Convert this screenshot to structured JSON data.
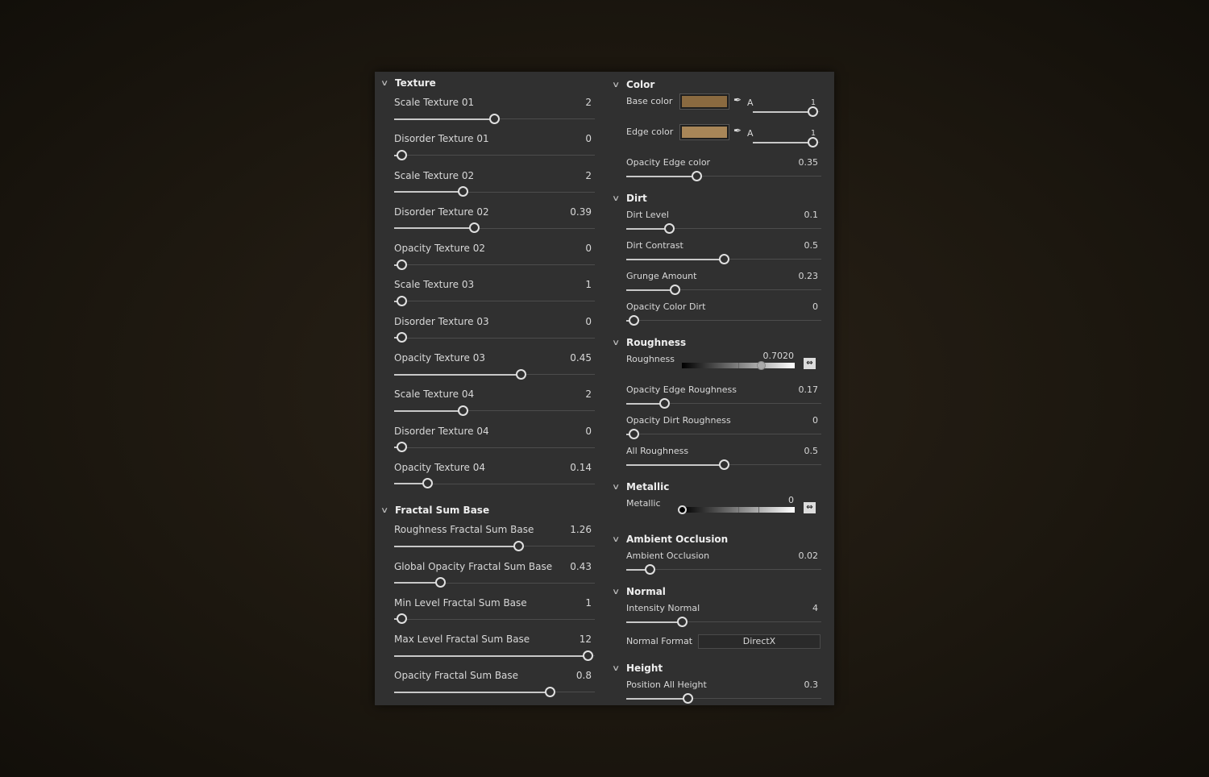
{
  "left": [
    {
      "title": "Texture",
      "rows": [
        {
          "label": "Scale Texture 01",
          "value": "2",
          "fraction": 0.5
        },
        {
          "label": "Disorder Texture 01",
          "value": "0",
          "fraction": 0
        },
        {
          "label": "Scale Texture 02",
          "value": "2",
          "fraction": 0.33
        },
        {
          "label": "Disorder Texture 02",
          "value": "0.39",
          "fraction": 0.39
        },
        {
          "label": "Opacity Texture 02",
          "value": "0",
          "fraction": 0
        },
        {
          "label": "Scale Texture 03",
          "value": "1",
          "fraction": 0
        },
        {
          "label": "Disorder Texture 03",
          "value": "0",
          "fraction": 0
        },
        {
          "label": "Opacity Texture 03",
          "value": "0.45",
          "fraction": 0.645
        },
        {
          "label": "Scale Texture 04",
          "value": "2",
          "fraction": 0.33
        },
        {
          "label": "Disorder Texture 04",
          "value": "0",
          "fraction": 0
        },
        {
          "label": "Opacity Texture 04",
          "value": "0.14",
          "fraction": 0.14
        }
      ]
    },
    {
      "title": "Fractal Sum Base",
      "rows": [
        {
          "label": "Roughness Fractal Sum Base",
          "value": "1.26",
          "fraction": 0.63
        },
        {
          "label": "Global Opacity Fractal Sum Base",
          "value": "0.43",
          "fraction": 0.21
        },
        {
          "label": "Min Level Fractal Sum Base",
          "value": "1",
          "fraction": 0
        },
        {
          "label": "Max Level Fractal Sum Base",
          "value": "12",
          "fraction": 1
        },
        {
          "label": "Opacity Fractal Sum Base",
          "value": "0.8",
          "fraction": 0.8
        }
      ]
    }
  ],
  "right": [
    {
      "title": "Color",
      "rows": [
        {
          "type": "color",
          "label": "Base color",
          "color": "#8a6a40",
          "alpha_label": "A",
          "alpha_value": "1",
          "alpha_fraction": 1
        },
        {
          "type": "color",
          "label": "Edge color",
          "color": "#a88658",
          "alpha_label": "A",
          "alpha_value": "1",
          "alpha_fraction": 1
        },
        {
          "type": "slider",
          "label": "Opacity Edge color",
          "value": "0.35",
          "fraction": 0.35
        }
      ]
    },
    {
      "title": "Dirt",
      "rows": [
        {
          "type": "slider",
          "label": "Dirt Level",
          "value": "0.1",
          "fraction": 0.2
        },
        {
          "type": "slider",
          "label": "Dirt Contrast",
          "value": "0.5",
          "fraction": 0.5
        },
        {
          "type": "slider",
          "label": "Grunge Amount",
          "value": "0.23",
          "fraction": 0.23
        },
        {
          "type": "slider",
          "label": "Opacity Color Dirt",
          "value": "0",
          "fraction": 0
        }
      ]
    },
    {
      "title": "Roughness",
      "rows": [
        {
          "type": "gradient",
          "label": "Roughness",
          "value": "0.7020",
          "fraction": 0.702
        },
        {
          "type": "slider",
          "label": "Opacity Edge Roughness",
          "value": "0.17",
          "fraction": 0.17
        },
        {
          "type": "slider",
          "label": "Opacity Dirt Roughness",
          "value": "0",
          "fraction": 0
        },
        {
          "type": "slider",
          "label": "All Roughness",
          "value": "0.5",
          "fraction": 0.5
        }
      ]
    },
    {
      "title": "Metallic",
      "rows": [
        {
          "type": "gradient",
          "label": "Metallic",
          "value": "0",
          "fraction": 0
        }
      ]
    },
    {
      "title": "Ambient Occlusion",
      "rows": [
        {
          "type": "slider",
          "label": "Ambient Occlusion",
          "value": "0.02",
          "fraction": 0.09
        }
      ]
    },
    {
      "title": "Normal",
      "rows": [
        {
          "type": "slider",
          "label": "Intensity Normal",
          "value": "4",
          "fraction": 0.27
        },
        {
          "type": "select",
          "label": "Normal Format",
          "value": "DirectX"
        }
      ]
    },
    {
      "title": "Height",
      "rows": [
        {
          "type": "slider",
          "label": "Position All Height",
          "value": "0.3",
          "fraction": 0.3
        }
      ]
    }
  ]
}
